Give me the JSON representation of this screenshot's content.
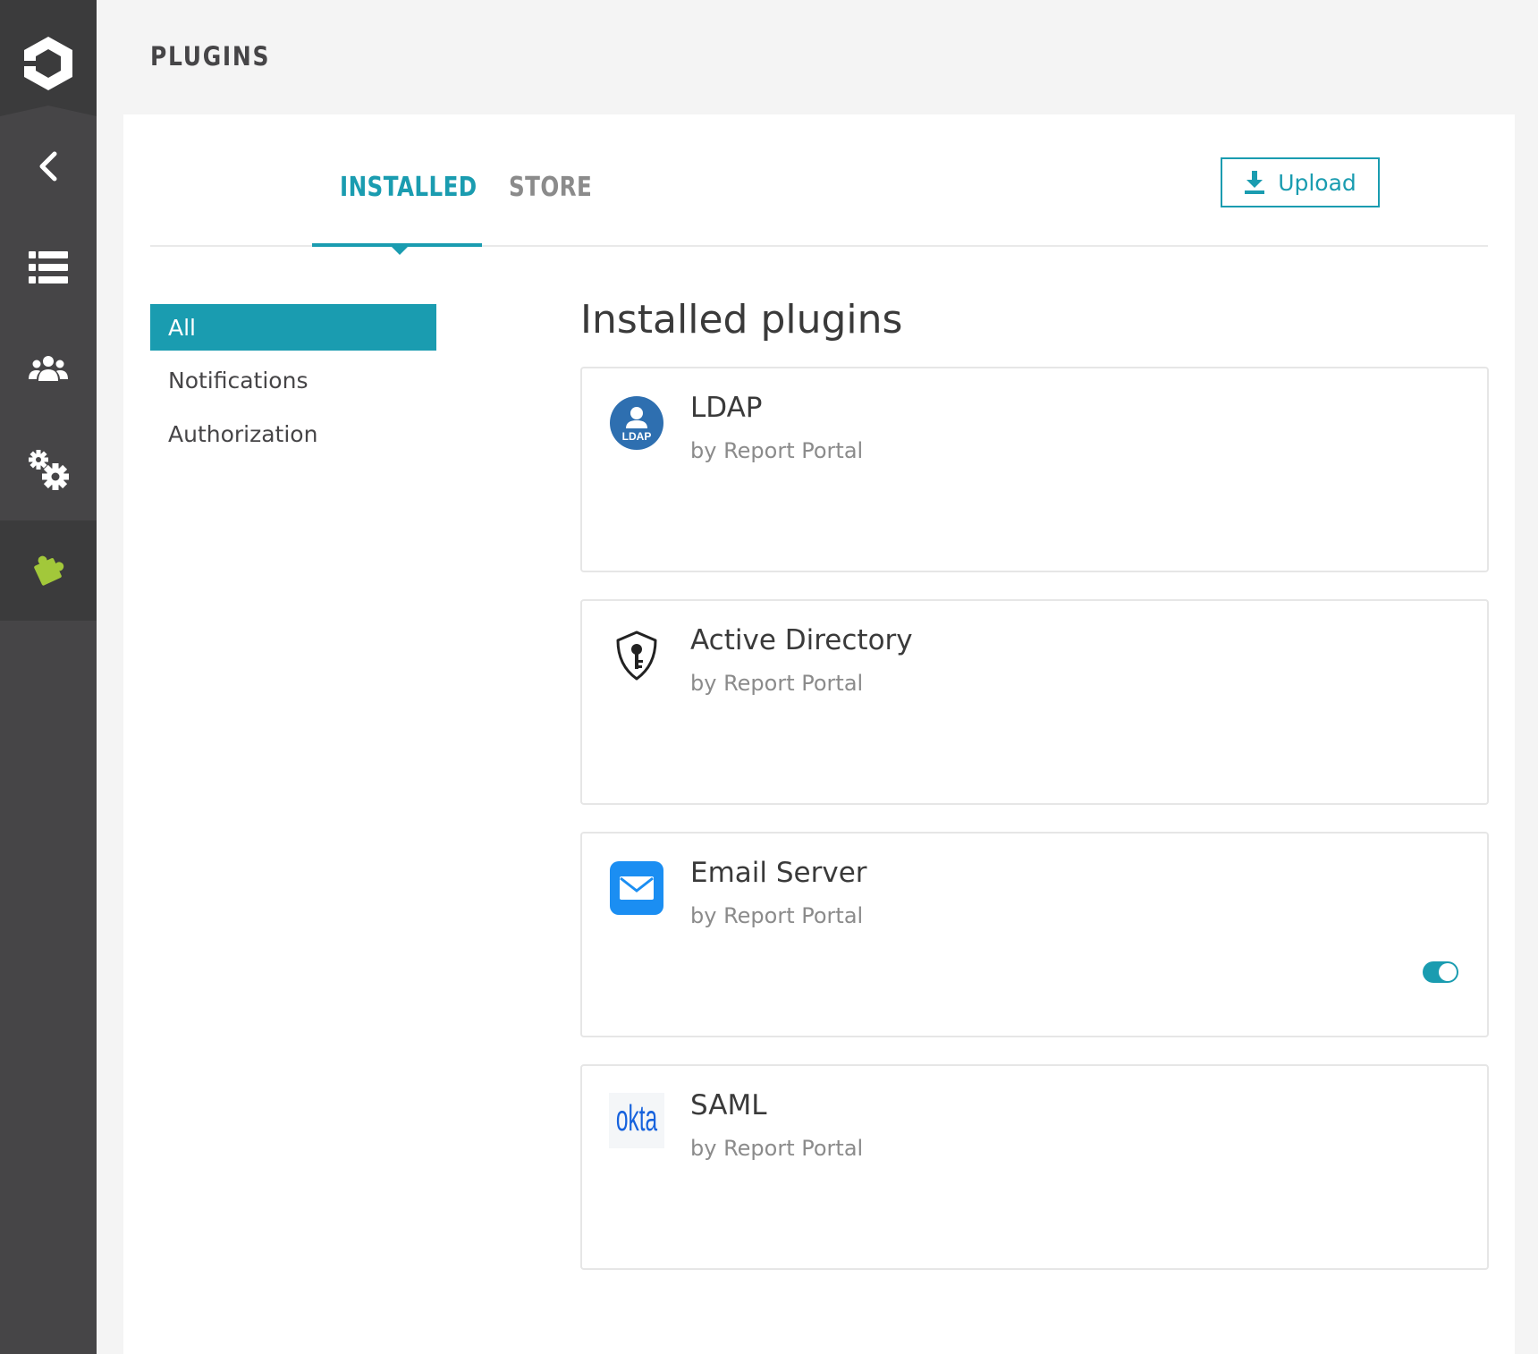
{
  "header": {
    "title": "PLUGINS"
  },
  "sidebar": {
    "items": [
      {
        "icon": "back-chevron-icon",
        "active": false
      },
      {
        "icon": "launches-list-icon",
        "active": false
      },
      {
        "icon": "members-icon",
        "active": false
      },
      {
        "icon": "settings-icon",
        "active": false
      },
      {
        "icon": "plugins-puzzle-icon",
        "active": true
      }
    ]
  },
  "tabs": [
    {
      "label": "INSTALLED",
      "active": true
    },
    {
      "label": "STORE",
      "active": false
    }
  ],
  "toolbar": {
    "upload_label": "Upload"
  },
  "filters": [
    {
      "label": "All",
      "active": true
    },
    {
      "label": "Notifications",
      "active": false
    },
    {
      "label": "Authorization",
      "active": false
    }
  ],
  "main": {
    "section_title": "Installed plugins",
    "plugins": [
      {
        "name": "LDAP",
        "author": "by Report Portal",
        "icon": "ldap-icon",
        "icon_text": "LDAP"
      },
      {
        "name": "Active Directory",
        "author": "by Report Portal",
        "icon": "shield-key-icon"
      },
      {
        "name": "Email Server",
        "author": "by Report Portal",
        "icon": "email-icon",
        "enabled": true
      },
      {
        "name": "SAML",
        "author": "by Report Portal",
        "icon": "okta-logo-icon",
        "icon_text": "okta"
      }
    ]
  },
  "colors": {
    "accent": "#1a9cb0",
    "sidebar": "#464547",
    "sidebar_active": "#3b3b3c",
    "plugin_active": "#a2c83a"
  }
}
